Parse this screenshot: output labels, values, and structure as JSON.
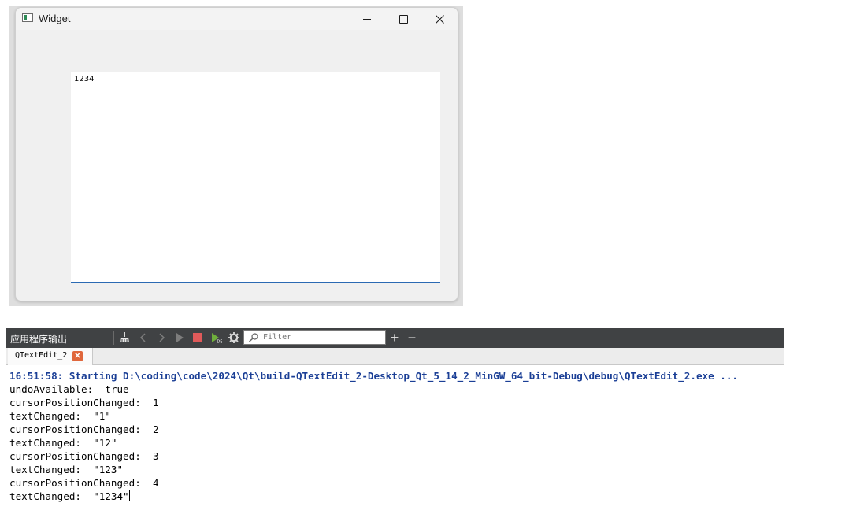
{
  "widget_window": {
    "title": "Widget",
    "controls": {
      "minimize": "minimize-icon",
      "maximize": "maximize-icon",
      "close": "close-icon"
    },
    "text_edit_content": "1234"
  },
  "output_pane": {
    "title": "应用程序输出",
    "toolbar_icons": [
      "clean-icon",
      "prev-icon",
      "next-icon",
      "run-icon",
      "stop-icon",
      "attach-debugger-icon",
      "settings-icon"
    ],
    "filter_placeholder": "Filter",
    "zoom_in_label": "+",
    "zoom_out_label": "−",
    "tab": {
      "label": "QTextEdit_2"
    },
    "lines": [
      "16:51:58: Starting D:\\coding\\code\\2024\\Qt\\build-QTextEdit_2-Desktop_Qt_5_14_2_MinGW_64_bit-Debug\\debug\\QTextEdit_2.exe ...",
      "undoAvailable:  true",
      "cursorPositionChanged:  1",
      "textChanged:  \"1\"",
      "cursorPositionChanged:  2",
      "textChanged:  \"12\"",
      "cursorPositionChanged:  3",
      "textChanged:  \"123\"",
      "cursorPositionChanged:  4",
      "textChanged:  \"1234\""
    ]
  },
  "colors": {
    "toolbar_bg": "#404244",
    "start_line": "#1b3f96",
    "stop_red": "#e05a5a",
    "accent_blue": "#2b6ab3"
  }
}
